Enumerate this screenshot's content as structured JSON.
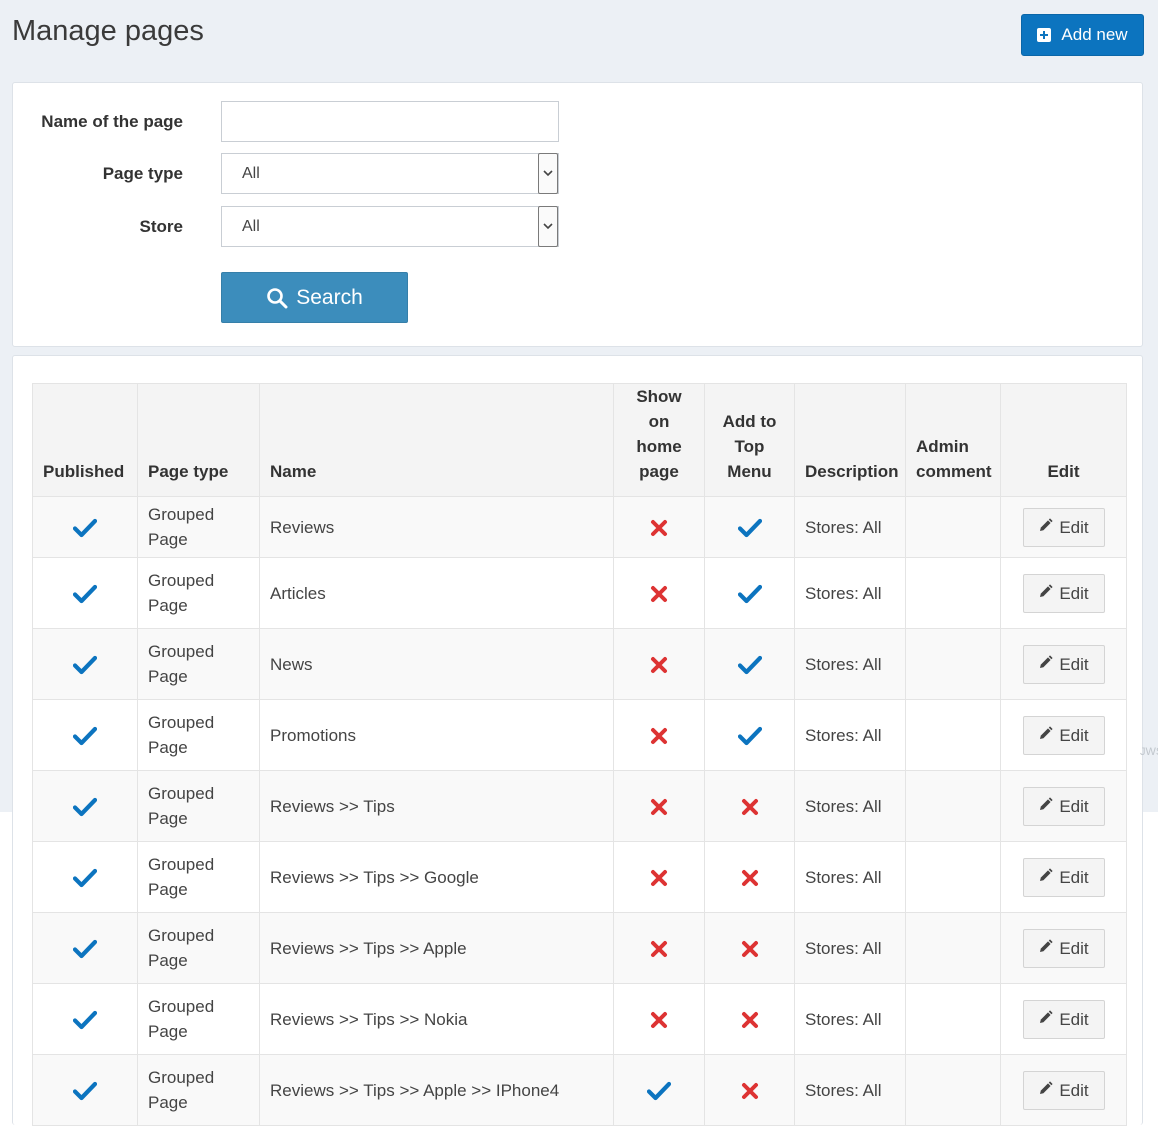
{
  "header": {
    "title": "Manage pages",
    "add_new_label": "Add new"
  },
  "search": {
    "name_label": "Name of the page",
    "name_value": "",
    "page_type_label": "Page type",
    "page_type_value": "All",
    "store_label": "Store",
    "store_value": "All",
    "search_label": "Search"
  },
  "grid": {
    "columns": {
      "published": "Published",
      "page_type": "Page type",
      "name": "Name",
      "show_on_home": [
        "Show on",
        "home",
        "page"
      ],
      "add_to_top_menu": [
        "Add to",
        "Top",
        "Menu"
      ],
      "description": "Description",
      "admin_comment": [
        "Admin",
        "comment"
      ],
      "edit": "Edit"
    },
    "rows": [
      {
        "published": true,
        "type_line1": "Grouped",
        "type_line2": "Page",
        "name": "Reviews",
        "show_on_home": false,
        "top_menu": true,
        "description": "Stores: All",
        "admin_comment": "",
        "edit_label": "Edit"
      },
      {
        "published": true,
        "type_line1": "Grouped",
        "type_line2": "Page",
        "name": "Articles",
        "show_on_home": false,
        "top_menu": true,
        "description": "Stores: All",
        "admin_comment": "",
        "edit_label": "Edit"
      },
      {
        "published": true,
        "type_line1": "Grouped",
        "type_line2": "Page",
        "name": "News",
        "show_on_home": false,
        "top_menu": true,
        "description": "Stores: All",
        "admin_comment": "",
        "edit_label": "Edit"
      },
      {
        "published": true,
        "type_line1": "Grouped",
        "type_line2": "Page",
        "name": "Promotions",
        "show_on_home": false,
        "top_menu": true,
        "description": "Stores: All",
        "admin_comment": "",
        "edit_label": "Edit"
      },
      {
        "published": true,
        "type_line1": "Grouped",
        "type_line2": "Page",
        "name": "Reviews >> Tips",
        "show_on_home": false,
        "top_menu": false,
        "description": "Stores: All",
        "admin_comment": "",
        "edit_label": "Edit"
      },
      {
        "published": true,
        "type_line1": "Grouped",
        "type_line2": "Page",
        "name": "Reviews >> Tips >> Google",
        "show_on_home": false,
        "top_menu": false,
        "description": "Stores: All",
        "admin_comment": "",
        "edit_label": "Edit"
      },
      {
        "published": true,
        "type_line1": "Grouped",
        "type_line2": "Page",
        "name": "Reviews >> Tips >> Apple",
        "show_on_home": false,
        "top_menu": false,
        "description": "Stores: All",
        "admin_comment": "",
        "edit_label": "Edit"
      },
      {
        "published": true,
        "type_line1": "Grouped",
        "type_line2": "Page",
        "name": "Reviews >> Tips >> Nokia",
        "show_on_home": false,
        "top_menu": false,
        "description": "Stores: All",
        "admin_comment": "",
        "edit_label": "Edit"
      },
      {
        "published": true,
        "type_line1": "Grouped",
        "type_line2": "Page",
        "name": "Reviews >> Tips >> Apple >> IPhone4",
        "show_on_home": true,
        "top_menu": false,
        "description": "Stores: All",
        "admin_comment": "",
        "edit_label": "Edit"
      }
    ]
  },
  "icons": {
    "add": "plus-square-icon",
    "search": "search-icon",
    "true": "check-icon",
    "false": "cross-icon",
    "edit": "pencil-icon",
    "select": "chevron-down-icon"
  },
  "colors": {
    "background": "#ecf0f5",
    "primary": "#0c74bf",
    "search_button": "#3c8dbc",
    "check": "#0c74bf",
    "cross": "#dd3333"
  },
  "edge_text": "JWS"
}
